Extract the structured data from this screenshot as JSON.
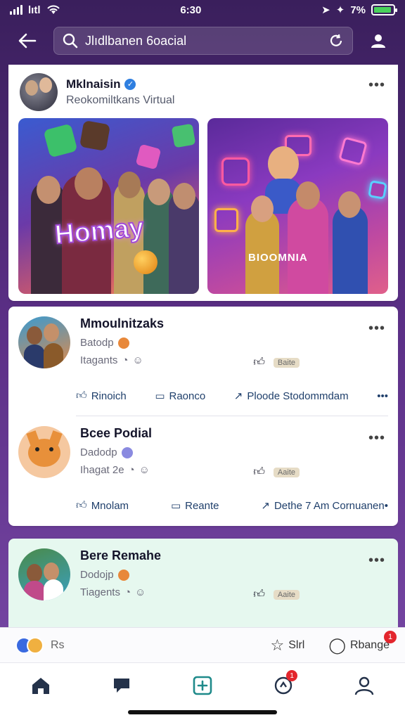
{
  "status_bar": {
    "time": "6:30",
    "carrier": "lıtl",
    "battery_text": "7%",
    "battery_level": 0.92
  },
  "search": {
    "value": "Jlıdlbanen 6oacial"
  },
  "post_top": {
    "name": "Mklnaisin",
    "subtitle": "Reokomiltkans  Virtual",
    "more": "•••",
    "image_left_text": "Homay",
    "image_right_text": "BIOOMNIA"
  },
  "posts": [
    {
      "name": "Mmoulnitzaks",
      "line1": "Batodp",
      "line2": "Itagants",
      "pill": "Baite",
      "more": "•••",
      "actions": {
        "a": "Rinoich",
        "b": "Raonco",
        "c": "Ploode Stodommdam",
        "d": "•••"
      }
    },
    {
      "name": "Bcee Podial",
      "line1": "Dadodp",
      "line2": "Ihagat 2e",
      "pill": "Aaite",
      "more": "•••",
      "actions": {
        "a": "Mnolam",
        "b": "Reante",
        "c": "Dethe 7 Am Cornuanen•"
      }
    }
  ],
  "post_bottom": {
    "name": "Bere Remahe",
    "line1": "Dodojp",
    "line2": "Tiagents",
    "pill": "Aaite",
    "more": "•••"
  },
  "sharebar": {
    "count": "Rs",
    "star_label": "Slrl",
    "comment_label": "Rbange",
    "comment_badge": "1"
  },
  "nav": {
    "notif_badge": "1"
  },
  "colors": {
    "accent": "#5b2f86",
    "link": "#1f3f6b",
    "badge": "#e3262d",
    "mint": "#e6f8ef"
  }
}
